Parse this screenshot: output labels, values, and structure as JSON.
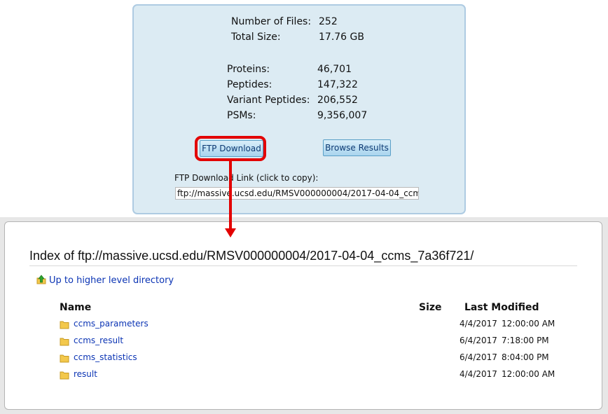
{
  "summary": {
    "stats_top": [
      {
        "label": "Number of Files:",
        "value": "252"
      },
      {
        "label": "Total Size:",
        "value": "17.76 GB"
      }
    ],
    "stats_counts": [
      {
        "label": "Proteins:",
        "value": "46,701"
      },
      {
        "label": "Peptides:",
        "value": "147,322"
      },
      {
        "label": "Variant Peptides:",
        "value": "206,552"
      },
      {
        "label": "PSMs:",
        "value": "9,356,007"
      }
    ],
    "ftp_button_label": "FTP Download",
    "browse_button_label": "Browse Results",
    "ftp_link_label": "FTP Download Link (click to copy):",
    "ftp_link_value": "ftp://massive.ucsd.edu/RMSV000000004/2017-04-04_ccm"
  },
  "listing": {
    "title": "Index of ftp://massive.ucsd.edu/RMSV000000004/2017-04-04_ccms_7a36f721/",
    "up_link": "Up to higher level directory",
    "columns": {
      "name": "Name",
      "size": "Size",
      "modified": "Last Modified"
    },
    "entries": [
      {
        "name": "ccms_parameters",
        "date": "4/4/2017",
        "time": "12:00:00 AM"
      },
      {
        "name": "ccms_result",
        "date": "6/4/2017",
        "time": "7:18:00 PM"
      },
      {
        "name": "ccms_statistics",
        "date": "6/4/2017",
        "time": "8:04:00 PM"
      },
      {
        "name": "result",
        "date": "4/4/2017",
        "time": "12:00:00 AM"
      }
    ]
  },
  "colors": {
    "panel_bg": "#dcebf3",
    "highlight": "#e30000",
    "link": "#0b34b4",
    "folder": "#f3c84c"
  },
  "icons": {
    "up": "up-directory-icon",
    "folder": "folder-icon"
  }
}
